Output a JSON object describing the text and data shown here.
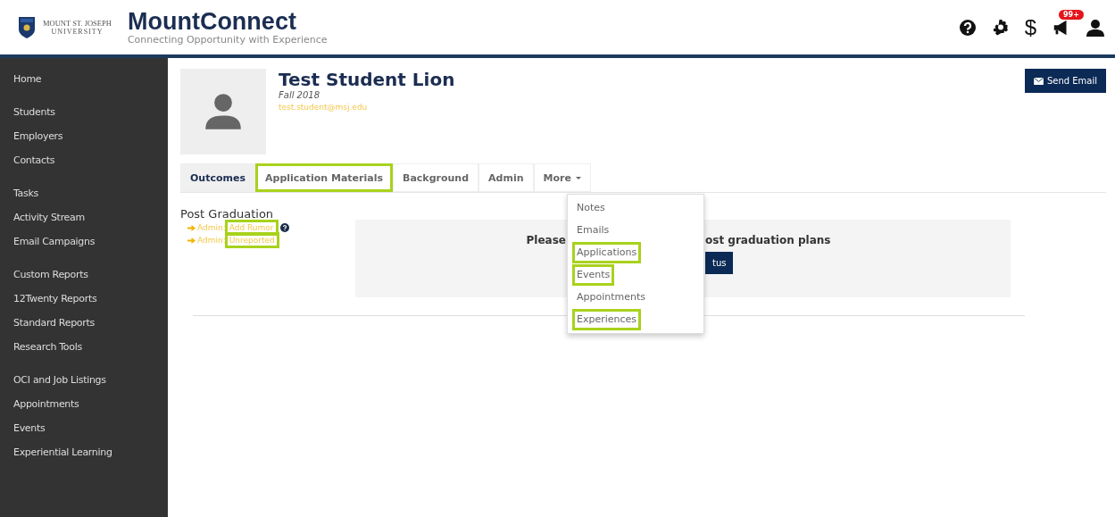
{
  "header": {
    "logo_text": "MOUNT ST. JOSEPH",
    "logo_subtext": "UNIVERSITY",
    "title": "MountConnect",
    "tagline": "Connecting Opportunity with Experience",
    "icons": [
      {
        "kind": "help"
      },
      {
        "kind": "settings"
      },
      {
        "kind": "dollar",
        "text": "$"
      },
      {
        "kind": "announce",
        "badge": "99+"
      },
      {
        "kind": "user"
      }
    ]
  },
  "sidebar": {
    "groups": [
      [
        "Home"
      ],
      [
        "Students",
        "Employers",
        "Contacts"
      ],
      [
        "Tasks",
        "Activity Stream",
        "Email Campaigns"
      ],
      [
        "Custom Reports",
        "12Twenty Reports",
        "Standard Reports",
        "Research Tools"
      ],
      [
        "OCI and Job Listings",
        "Appointments",
        "Events",
        "Experiential Learning"
      ]
    ]
  },
  "profile": {
    "name": "Test Student Lion",
    "term": "Fall 2018",
    "email": "test.student@msj.edu"
  },
  "send_email": "Send Email",
  "tabs": [
    {
      "label": "Outcomes",
      "selected": true,
      "highlighted": false
    },
    {
      "label": "Application Materials",
      "selected": false,
      "highlighted": true
    },
    {
      "label": "Background",
      "selected": false,
      "highlighted": false
    },
    {
      "label": "Admin",
      "selected": false,
      "highlighted": false
    },
    {
      "label": "More",
      "selected": false,
      "highlighted": false,
      "dropdown": true
    }
  ],
  "more_menu": [
    {
      "label": "Notes",
      "highlighted": false
    },
    {
      "label": "Emails",
      "highlighted": false
    },
    {
      "label": "Applications",
      "highlighted": true
    },
    {
      "label": "Events",
      "highlighted": true
    },
    {
      "label": "Appointments",
      "highlighted": false
    },
    {
      "label": "Experiences",
      "highlighted": true
    }
  ],
  "post_graduation": {
    "heading": "Post Graduation",
    "links": [
      {
        "prefix": "Admin:",
        "label": "Add Rumor",
        "highlighted": true,
        "help": true
      },
      {
        "prefix": "Admin:",
        "label": "Unreported",
        "highlighted": true,
        "help": false
      }
    ],
    "panel_text_left": "Please",
    "panel_text_right": "ost graduation plans",
    "button": "tus"
  }
}
